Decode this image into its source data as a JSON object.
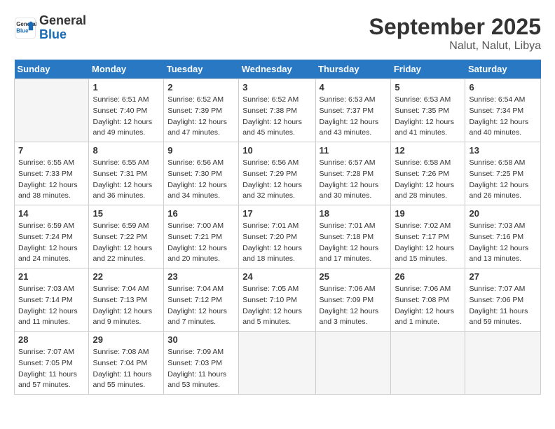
{
  "logo": {
    "line1": "General",
    "line2": "Blue"
  },
  "title": "September 2025",
  "location": "Nalut, Nalut, Libya",
  "weekdays": [
    "Sunday",
    "Monday",
    "Tuesday",
    "Wednesday",
    "Thursday",
    "Friday",
    "Saturday"
  ],
  "weeks": [
    [
      {
        "day": "",
        "info": ""
      },
      {
        "day": "1",
        "info": "Sunrise: 6:51 AM\nSunset: 7:40 PM\nDaylight: 12 hours\nand 49 minutes."
      },
      {
        "day": "2",
        "info": "Sunrise: 6:52 AM\nSunset: 7:39 PM\nDaylight: 12 hours\nand 47 minutes."
      },
      {
        "day": "3",
        "info": "Sunrise: 6:52 AM\nSunset: 7:38 PM\nDaylight: 12 hours\nand 45 minutes."
      },
      {
        "day": "4",
        "info": "Sunrise: 6:53 AM\nSunset: 7:37 PM\nDaylight: 12 hours\nand 43 minutes."
      },
      {
        "day": "5",
        "info": "Sunrise: 6:53 AM\nSunset: 7:35 PM\nDaylight: 12 hours\nand 41 minutes."
      },
      {
        "day": "6",
        "info": "Sunrise: 6:54 AM\nSunset: 7:34 PM\nDaylight: 12 hours\nand 40 minutes."
      }
    ],
    [
      {
        "day": "7",
        "info": "Sunrise: 6:55 AM\nSunset: 7:33 PM\nDaylight: 12 hours\nand 38 minutes."
      },
      {
        "day": "8",
        "info": "Sunrise: 6:55 AM\nSunset: 7:31 PM\nDaylight: 12 hours\nand 36 minutes."
      },
      {
        "day": "9",
        "info": "Sunrise: 6:56 AM\nSunset: 7:30 PM\nDaylight: 12 hours\nand 34 minutes."
      },
      {
        "day": "10",
        "info": "Sunrise: 6:56 AM\nSunset: 7:29 PM\nDaylight: 12 hours\nand 32 minutes."
      },
      {
        "day": "11",
        "info": "Sunrise: 6:57 AM\nSunset: 7:28 PM\nDaylight: 12 hours\nand 30 minutes."
      },
      {
        "day": "12",
        "info": "Sunrise: 6:58 AM\nSunset: 7:26 PM\nDaylight: 12 hours\nand 28 minutes."
      },
      {
        "day": "13",
        "info": "Sunrise: 6:58 AM\nSunset: 7:25 PM\nDaylight: 12 hours\nand 26 minutes."
      }
    ],
    [
      {
        "day": "14",
        "info": "Sunrise: 6:59 AM\nSunset: 7:24 PM\nDaylight: 12 hours\nand 24 minutes."
      },
      {
        "day": "15",
        "info": "Sunrise: 6:59 AM\nSunset: 7:22 PM\nDaylight: 12 hours\nand 22 minutes."
      },
      {
        "day": "16",
        "info": "Sunrise: 7:00 AM\nSunset: 7:21 PM\nDaylight: 12 hours\nand 20 minutes."
      },
      {
        "day": "17",
        "info": "Sunrise: 7:01 AM\nSunset: 7:20 PM\nDaylight: 12 hours\nand 18 minutes."
      },
      {
        "day": "18",
        "info": "Sunrise: 7:01 AM\nSunset: 7:18 PM\nDaylight: 12 hours\nand 17 minutes."
      },
      {
        "day": "19",
        "info": "Sunrise: 7:02 AM\nSunset: 7:17 PM\nDaylight: 12 hours\nand 15 minutes."
      },
      {
        "day": "20",
        "info": "Sunrise: 7:03 AM\nSunset: 7:16 PM\nDaylight: 12 hours\nand 13 minutes."
      }
    ],
    [
      {
        "day": "21",
        "info": "Sunrise: 7:03 AM\nSunset: 7:14 PM\nDaylight: 12 hours\nand 11 minutes."
      },
      {
        "day": "22",
        "info": "Sunrise: 7:04 AM\nSunset: 7:13 PM\nDaylight: 12 hours\nand 9 minutes."
      },
      {
        "day": "23",
        "info": "Sunrise: 7:04 AM\nSunset: 7:12 PM\nDaylight: 12 hours\nand 7 minutes."
      },
      {
        "day": "24",
        "info": "Sunrise: 7:05 AM\nSunset: 7:10 PM\nDaylight: 12 hours\nand 5 minutes."
      },
      {
        "day": "25",
        "info": "Sunrise: 7:06 AM\nSunset: 7:09 PM\nDaylight: 12 hours\nand 3 minutes."
      },
      {
        "day": "26",
        "info": "Sunrise: 7:06 AM\nSunset: 7:08 PM\nDaylight: 12 hours\nand 1 minute."
      },
      {
        "day": "27",
        "info": "Sunrise: 7:07 AM\nSunset: 7:06 PM\nDaylight: 11 hours\nand 59 minutes."
      }
    ],
    [
      {
        "day": "28",
        "info": "Sunrise: 7:07 AM\nSunset: 7:05 PM\nDaylight: 11 hours\nand 57 minutes."
      },
      {
        "day": "29",
        "info": "Sunrise: 7:08 AM\nSunset: 7:04 PM\nDaylight: 11 hours\nand 55 minutes."
      },
      {
        "day": "30",
        "info": "Sunrise: 7:09 AM\nSunset: 7:03 PM\nDaylight: 11 hours\nand 53 minutes."
      },
      {
        "day": "",
        "info": ""
      },
      {
        "day": "",
        "info": ""
      },
      {
        "day": "",
        "info": ""
      },
      {
        "day": "",
        "info": ""
      }
    ]
  ]
}
